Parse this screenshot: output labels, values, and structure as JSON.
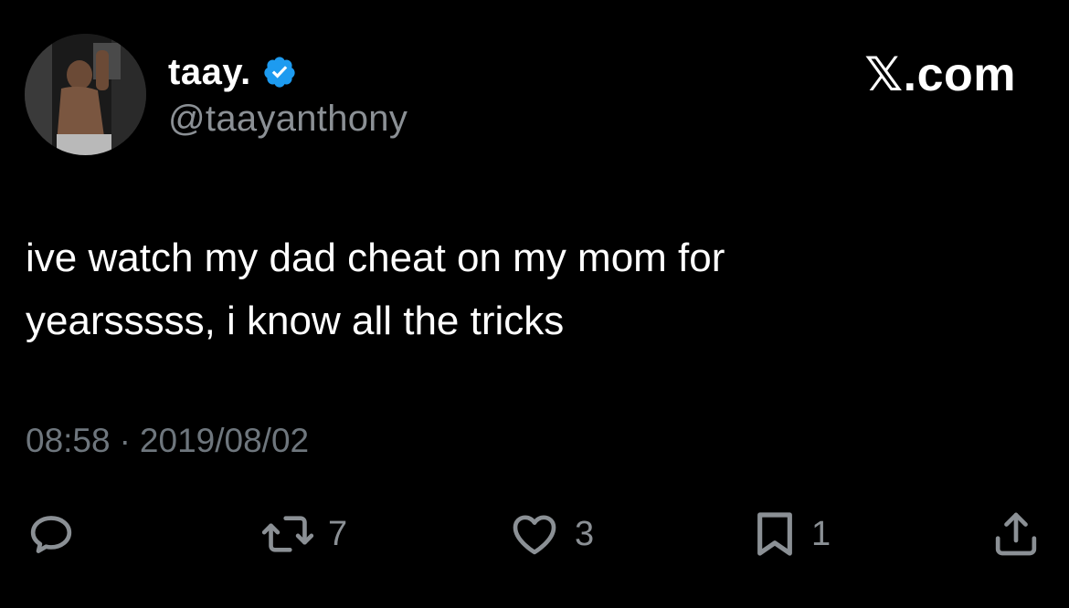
{
  "author": {
    "display_name": "taay.",
    "handle": "@taayanthony",
    "verified_icon": "verified-badge-icon",
    "verified_color": "#1d9bf0"
  },
  "watermark": "𝕏.com",
  "tweet": {
    "text": "ive watch my dad cheat on my mom for\nyearsssss, i know all the tricks",
    "time": "08:58",
    "separator": "·",
    "date": "2019/08/02"
  },
  "actions": {
    "reply": {
      "icon": "reply-icon"
    },
    "retweet": {
      "icon": "retweet-icon",
      "count": "7"
    },
    "like": {
      "icon": "heart-icon",
      "count": "3"
    },
    "bookmark": {
      "icon": "bookmark-icon",
      "count": "1"
    },
    "share": {
      "icon": "share-icon"
    }
  },
  "colors": {
    "background": "#000000",
    "primary_text": "#ffffff",
    "secondary_text": "#8b9095",
    "accent": "#1d9bf0"
  }
}
